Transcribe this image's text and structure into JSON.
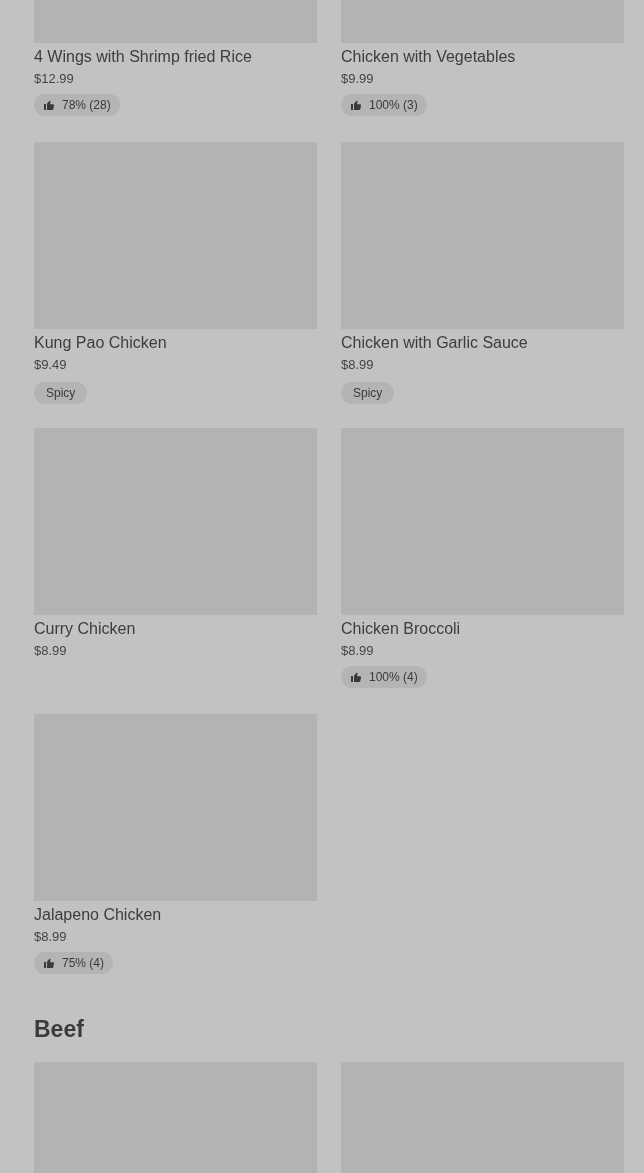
{
  "sections": [
    {
      "items": [
        {
          "kind": "dish",
          "name": "4 Wings with Shrimp fried Rice",
          "price": "$12.99",
          "badge": {
            "kind": "rating",
            "text": "78% (28)"
          }
        },
        {
          "kind": "dish",
          "name": "Chicken with Vegetables",
          "price": "$9.99",
          "badge": {
            "kind": "rating",
            "text": "100% (3)"
          }
        },
        {
          "kind": "dish",
          "name": "Kung Pao Chicken",
          "price": "$9.49",
          "badge": {
            "kind": "tag",
            "text": "Spicy"
          }
        },
        {
          "kind": "dish",
          "name": "Chicken with Garlic Sauce",
          "price": "$8.99",
          "badge": {
            "kind": "tag",
            "text": "Spicy"
          }
        },
        {
          "kind": "dish",
          "name": "Curry Chicken",
          "price": "$8.99"
        },
        {
          "kind": "dish",
          "name": "Chicken Broccoli",
          "price": "$8.99",
          "badge": {
            "kind": "rating",
            "text": "100% (4)"
          }
        },
        {
          "kind": "dish",
          "name": "Jalapeno Chicken",
          "price": "$8.99",
          "badge": {
            "kind": "rating",
            "text": "75% (4)"
          }
        }
      ]
    },
    {
      "title": "Beef",
      "items": [
        {
          "kind": "image_only"
        },
        {
          "kind": "image_only"
        }
      ]
    }
  ]
}
